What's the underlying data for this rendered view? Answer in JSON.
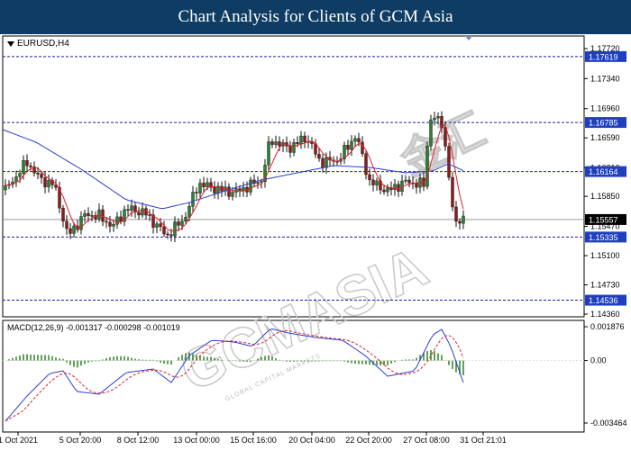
{
  "header": {
    "title": "Chart Analysis for Clients of GCM Asia"
  },
  "chart": {
    "symbol": "EURUSD,H4",
    "watermark": "GCMASIA",
    "watermark_cn": "金汇",
    "watermark_small": "GLOBAL CAPITAL MARKETS",
    "price_axis": [
      "1.17720",
      "1.17340",
      "1.16960",
      "1.16590",
      "1.16210",
      "1.15850",
      "1.15470",
      "1.15100",
      "1.14730",
      "1.14360"
    ],
    "time_axis": [
      "1 Oct 2021",
      "5 Oct 20:00",
      "8 Oct 12:00",
      "13 Oct 00:00",
      "15 Oct 16:00",
      "20 Oct 04:00",
      "22 Oct 20:00",
      "27 Oct 08:00",
      "31 Oct 21:01"
    ],
    "levels": [
      {
        "label": "1.17619",
        "value": 1.17619
      },
      {
        "label": "1.16785",
        "value": 1.16785
      },
      {
        "label": "1.16164",
        "value": 1.16164
      },
      {
        "label": "1.15335",
        "value": 1.15335
      },
      {
        "label": "1.14536",
        "value": 1.14536
      }
    ],
    "current_price": {
      "label": "1.15557",
      "value": 1.15557
    },
    "macd": {
      "label": "MACD(12,26,9) -0.001317 -0.000298 -0.001019",
      "axis": [
        "0.001876",
        "0.00",
        "-0.003464"
      ]
    },
    "colors": {
      "up": "#2e7d32",
      "down": "#8b1a1a",
      "ma_fast": "#e0202a",
      "ma_slow": "#2b3fd6",
      "level_line": "#1a1aa8",
      "badge": "#1f3fbf"
    }
  }
}
